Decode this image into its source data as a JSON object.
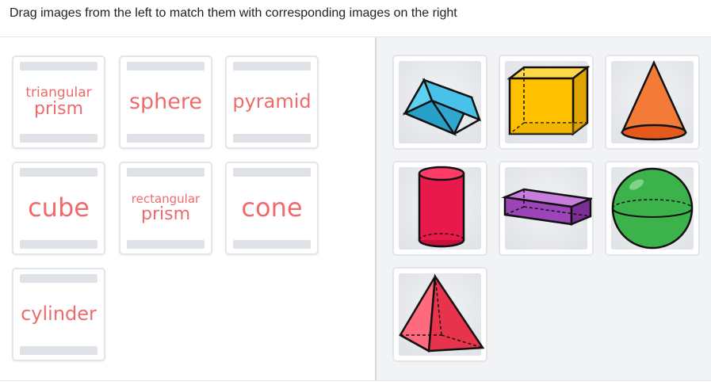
{
  "instruction": "Drag images from the left to match them with corresponding images on the right",
  "word_cards": [
    {
      "label": "triangular prism",
      "line1": "triangular",
      "line2": "prism"
    },
    {
      "label": "sphere"
    },
    {
      "label": "pyramid"
    },
    {
      "label": "cube"
    },
    {
      "label": "rectangular prism",
      "line1": "rectangular",
      "line2": "prism"
    },
    {
      "label": "cone"
    },
    {
      "label": "cylinder"
    }
  ],
  "image_cards": [
    {
      "shape": "triangular-prism-icon",
      "color": "#3bbde4"
    },
    {
      "shape": "cube-icon",
      "color": "#ffc000"
    },
    {
      "shape": "cone-icon",
      "color": "#f47a37"
    },
    {
      "shape": "cylinder-icon",
      "color": "#e8194b"
    },
    {
      "shape": "rectangular-prism-icon",
      "color": "#9b45b8"
    },
    {
      "shape": "sphere-icon",
      "color": "#3cb34a"
    },
    {
      "shape": "pyramid-icon",
      "color": "#f2475d"
    }
  ],
  "colors": {
    "word_text": "#ef6b6b",
    "right_panel_bg": "#f1f3f5"
  }
}
